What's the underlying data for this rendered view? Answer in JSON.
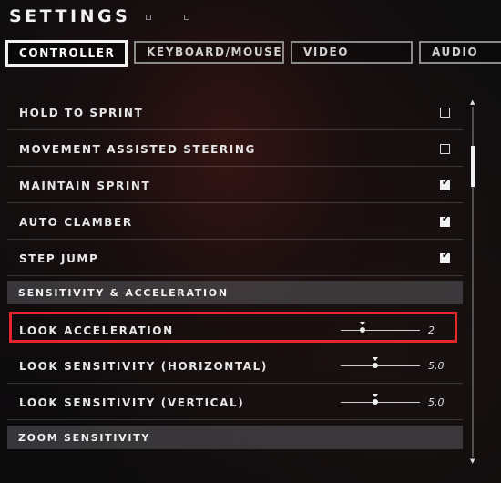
{
  "header": {
    "title": "SETTINGS"
  },
  "tabs": [
    {
      "label": "CONTROLLER",
      "active": true
    },
    {
      "label": "KEYBOARD/MOUSE",
      "active": false
    },
    {
      "label": "VIDEO",
      "active": false
    },
    {
      "label": "AUDIO",
      "active": false
    }
  ],
  "toggles": [
    {
      "label": "HOLD TO SPRINT",
      "checked": false
    },
    {
      "label": "MOVEMENT ASSISTED STEERING",
      "checked": false
    },
    {
      "label": "MAINTAIN SPRINT",
      "checked": true
    },
    {
      "label": "AUTO CLAMBER",
      "checked": true
    },
    {
      "label": "STEP JUMP",
      "checked": true
    }
  ],
  "sections": {
    "sensitivity": "SENSITIVITY & ACCELERATION",
    "zoom": "ZOOM SENSITIVITY"
  },
  "sliders": [
    {
      "label": "LOOK ACCELERATION",
      "value": "2",
      "fraction": 0.28,
      "highlighted": true
    },
    {
      "label": "LOOK SENSITIVITY (HORIZONTAL)",
      "value": "5.0",
      "fraction": 0.44,
      "highlighted": false
    },
    {
      "label": "LOOK SENSITIVITY (VERTICAL)",
      "value": "5.0",
      "fraction": 0.44,
      "highlighted": false
    }
  ],
  "colors": {
    "highlight": "#e8252c",
    "text": "#e6e6e6"
  },
  "icons": {
    "checkbox_checked": "checkmark-icon",
    "scroll_up": "scroll-up-arrow-icon",
    "scroll_down": "scroll-down-arrow-icon"
  }
}
